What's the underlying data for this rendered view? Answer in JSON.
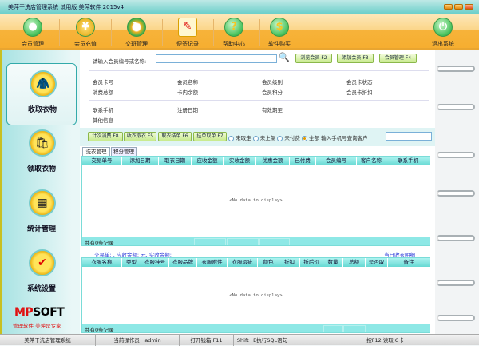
{
  "window": {
    "title": "美萍干洗店管理系统 试用版 美萍软件  2015v4"
  },
  "toolbar": [
    {
      "label": "会员管理",
      "icon": "member-icon"
    },
    {
      "label": "会员充值",
      "icon": "recharge-icon"
    },
    {
      "label": "交班管理",
      "icon": "shift-icon"
    },
    {
      "label": "便签记录",
      "icon": "note-icon"
    },
    {
      "label": "帮助中心",
      "icon": "help-icon"
    },
    {
      "label": "软件购买",
      "icon": "buy-icon"
    },
    {
      "label": "退出系统",
      "icon": "power-icon"
    }
  ],
  "sidebar": {
    "items": [
      {
        "label": "收取衣物"
      },
      {
        "label": "领取衣物"
      },
      {
        "label": "统计管理"
      },
      {
        "label": "系统设置"
      }
    ],
    "logo": "MPSOFT",
    "slogan": "管理软件 美萍是专家"
  },
  "search": {
    "label": "请输入会员编号或名称:",
    "value": "",
    "buttons": [
      "浏览会员 F2",
      "添加会员 F3",
      "会员管理 F4"
    ]
  },
  "member_info": {
    "row1": [
      "会员卡号",
      "会员名称",
      "会员级别",
      "会员卡状态"
    ],
    "row2": [
      "消费总额",
      "卡内余额",
      "会员积分",
      "会员卡折扣"
    ],
    "row3": [
      "联系手机",
      "注册日期",
      "有效期至"
    ],
    "row4": [
      "其他信息"
    ]
  },
  "actions": {
    "buttons": [
      "计次消费 F8",
      "收衣取衣 F5",
      "取衣结单 F6",
      "挂单取单 F7"
    ],
    "filters": [
      {
        "label": "未取走",
        "checked": false
      },
      {
        "label": "未上架",
        "checked": false
      },
      {
        "label": "未付费",
        "checked": false
      },
      {
        "label": "全部",
        "checked": true
      }
    ],
    "phone_label": "输入手机号查询客户",
    "phone_value": ""
  },
  "tabs": [
    {
      "label": "洗衣管理",
      "active": true
    },
    {
      "label": "积分管理",
      "active": false
    }
  ],
  "grid1": {
    "columns": [
      "交易单号",
      "添加日期",
      "取衣日期",
      "应收金额",
      "实收金额",
      "优惠金额",
      "已付费",
      "会员编号",
      "客户名称",
      "联系手机"
    ],
    "empty": "<No data to display>",
    "footer": "共有0条记录"
  },
  "summary": {
    "text": "交易单: , 应收金额: 元, 实收金额:",
    "link": "当日收衣明细"
  },
  "grid2": {
    "columns": [
      "衣服名称",
      "类型",
      "衣服挂号",
      "衣服品牌",
      "衣服附件",
      "衣服瑕疵",
      "颜色",
      "折扣",
      "折后价",
      "数量",
      "总额",
      "是否取",
      "备注"
    ],
    "empty": "<No data to display>",
    "footer": "共有0条记录"
  },
  "status": [
    "美萍干洗店管理系统",
    "当前操作员：admin",
    "打开钱箱 F11",
    "Shift+E执行SQL语句",
    "按F12 读取IC卡"
  ]
}
